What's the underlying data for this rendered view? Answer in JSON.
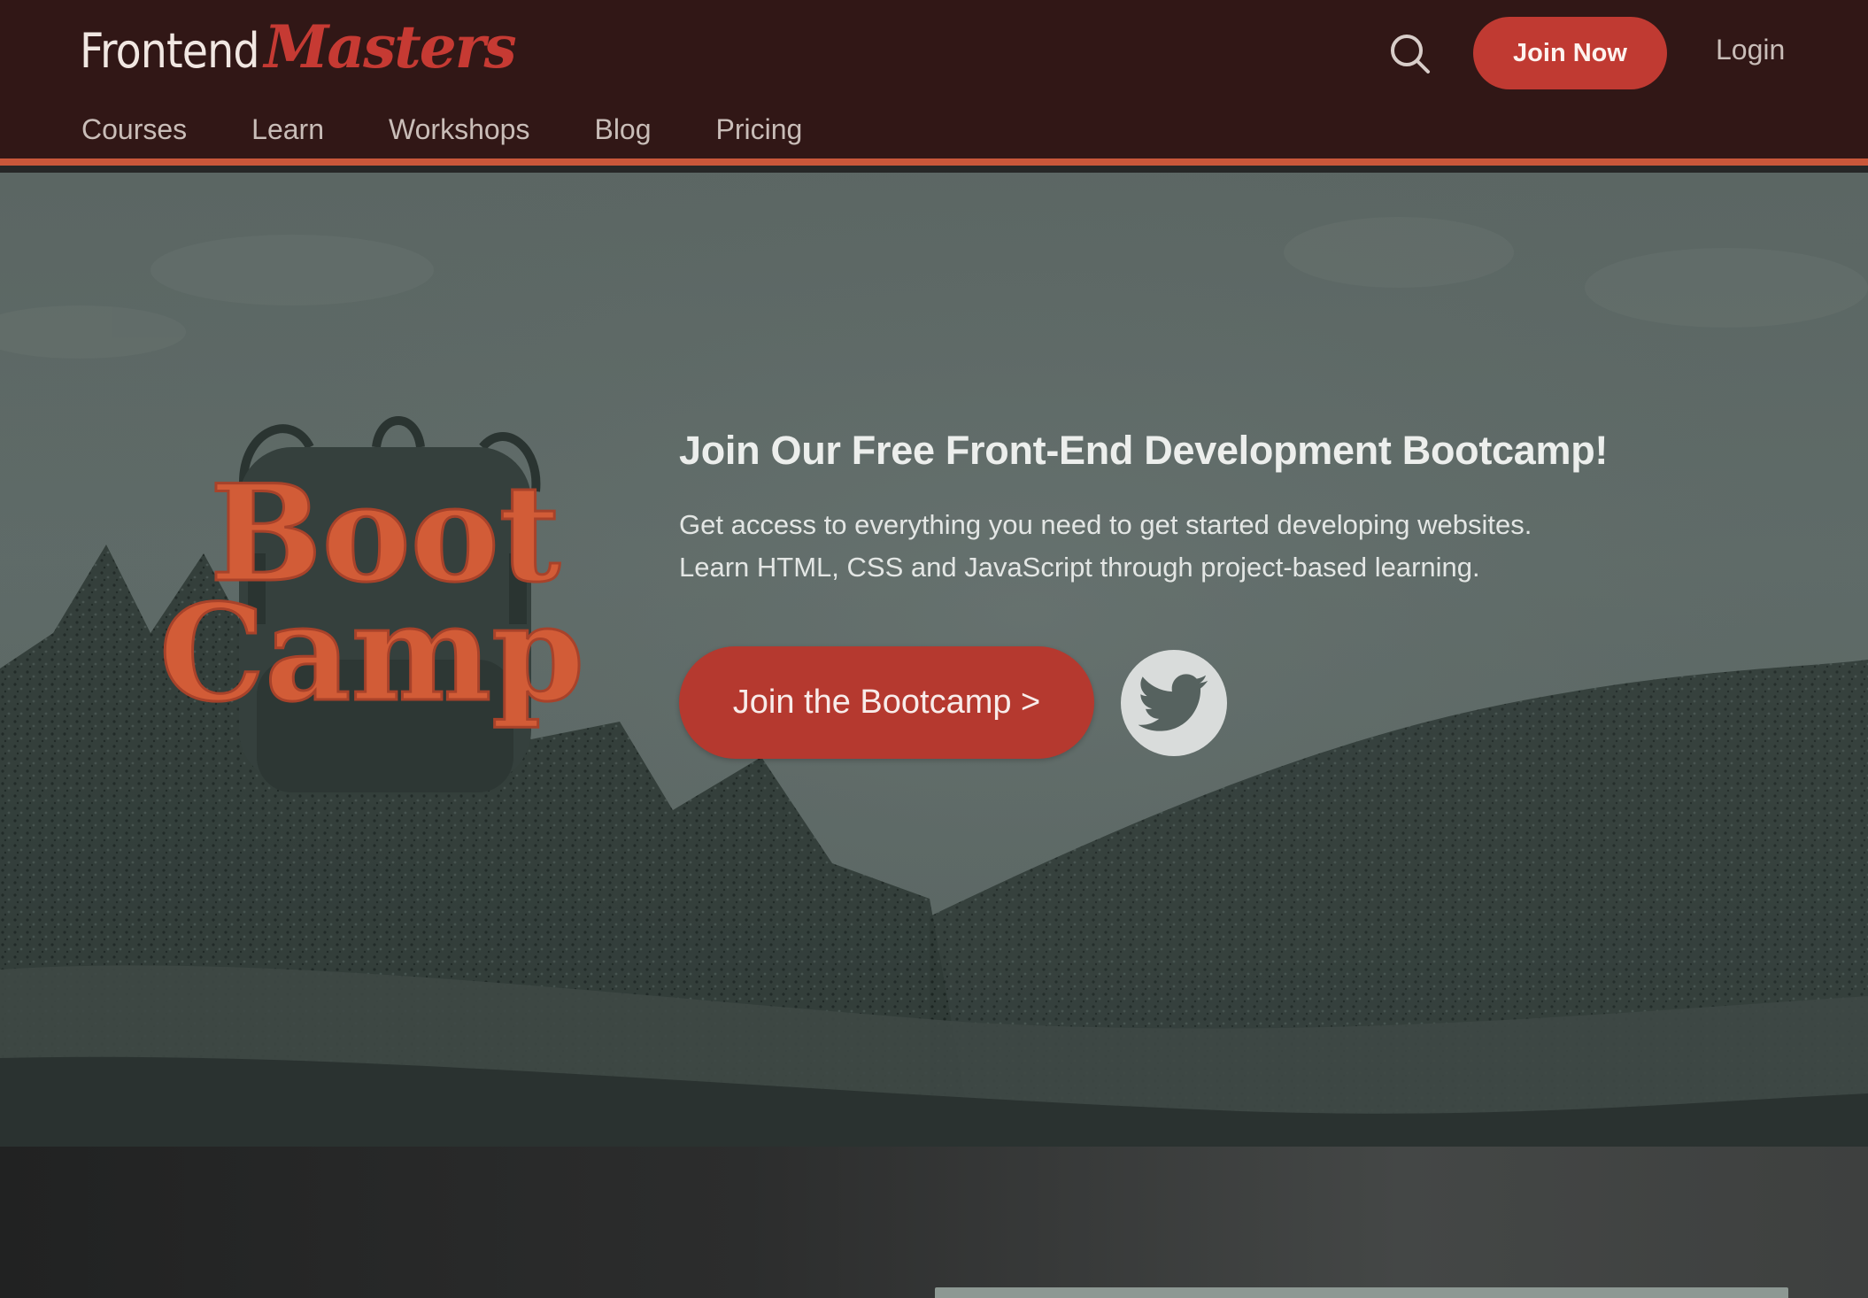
{
  "brand": {
    "logo_part1": "Frontend",
    "logo_part2": "Masters",
    "primary_color": "#c03a32",
    "header_bg": "#311716",
    "accent_line": "#c9573a"
  },
  "header": {
    "search_icon": "search-icon",
    "join_now_label": "Join Now",
    "login_label": "Login"
  },
  "nav": {
    "items": [
      {
        "label": "Courses"
      },
      {
        "label": "Learn"
      },
      {
        "label": "Workshops"
      },
      {
        "label": "Blog"
      },
      {
        "label": "Pricing"
      }
    ]
  },
  "hero": {
    "badge_line1": "Boot",
    "badge_line2": "Camp",
    "title": "Join Our Free Front-End Development Bootcamp!",
    "description_line1": "Get access to everything you need to get started developing websites.",
    "description_line2": "Learn HTML, CSS and JavaScript through project-based learning.",
    "cta_label": "Join the Bootcamp >",
    "twitter_icon": "twitter-bird-icon",
    "badge_color": "#d25c37"
  }
}
